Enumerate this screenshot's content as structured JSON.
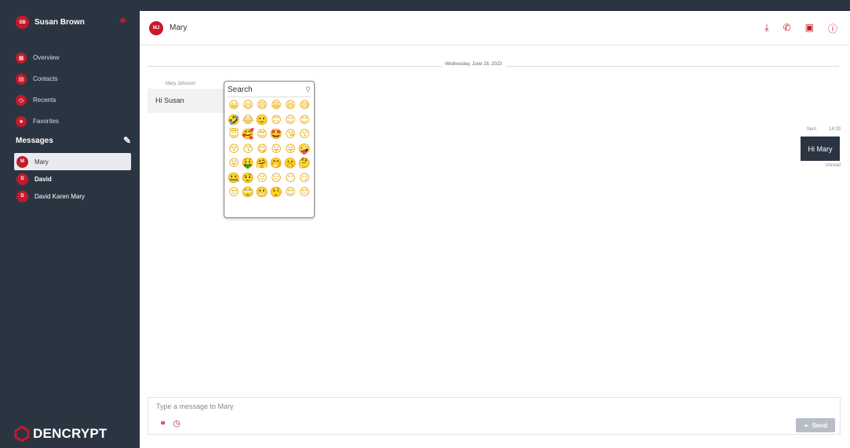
{
  "sidebar": {
    "user": {
      "initials": "SB",
      "name": "Susan Brown"
    },
    "nav": [
      {
        "label": "Overview",
        "icon": "▦"
      },
      {
        "label": "Contacts",
        "icon": "▤"
      },
      {
        "label": "Recents",
        "icon": "◷"
      },
      {
        "label": "Favorites",
        "icon": "★"
      }
    ],
    "messages_heading": "Messages",
    "conversations": [
      {
        "initials": "M",
        "name": "Mary"
      },
      {
        "initials": "D",
        "name": "David"
      },
      {
        "initials": "D",
        "name": "David Karen Mary"
      }
    ],
    "logo_text": "DENCRYPT"
  },
  "header": {
    "initials": "MJ",
    "name": "Mary"
  },
  "chat": {
    "date": "Wednesday, June 28, 2023",
    "incoming": {
      "sender": "Mary Johnson",
      "text": "Hi Susan"
    },
    "outgoing": {
      "status_left": "Sent",
      "time": "14:33",
      "text": "Hi Mary",
      "status": "Unread"
    }
  },
  "picker": {
    "search_placeholder": "Search",
    "emojis": [
      "😀",
      "😃",
      "😄",
      "😁",
      "😆",
      "😅",
      "🤣",
      "😂",
      "🙂",
      "🙃",
      "😉",
      "😊",
      "😇",
      "🥰",
      "😍",
      "🤩",
      "😘",
      "😗",
      "😚",
      "😙",
      "😋",
      "😛",
      "😜",
      "🤪",
      "😝",
      "🤑",
      "🤗",
      "🤭",
      "🤫",
      "🤔",
      "🤐",
      "🤨",
      "😐",
      "😑",
      "😶",
      "😏",
      "😒",
      "🙄",
      "😬",
      "🤥",
      "😌",
      "😔"
    ]
  },
  "composer": {
    "placeholder": "Type a message to Mary",
    "send_label": "Send"
  },
  "colors": {
    "accent": "#c41a2a",
    "sidebar": "#2b3542"
  }
}
